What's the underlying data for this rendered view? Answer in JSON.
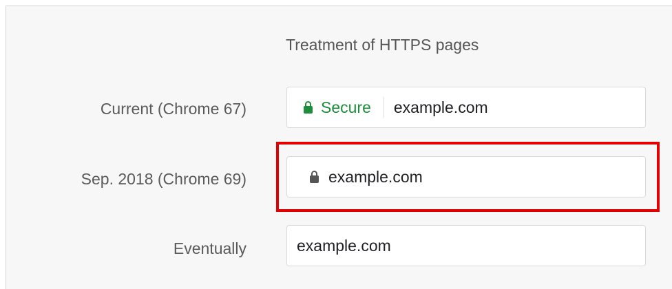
{
  "heading": "Treatment of HTTPS pages",
  "rows": [
    {
      "label": "Current (Chrome 67)",
      "security_text": "Secure",
      "url": "example.com",
      "lock_color": "#1e8e3e"
    },
    {
      "label": "Sep. 2018 (Chrome 69)",
      "url": "example.com",
      "lock_color": "#555555"
    },
    {
      "label": "Eventually",
      "url": "example.com"
    }
  ],
  "highlight_color": "#e30000"
}
